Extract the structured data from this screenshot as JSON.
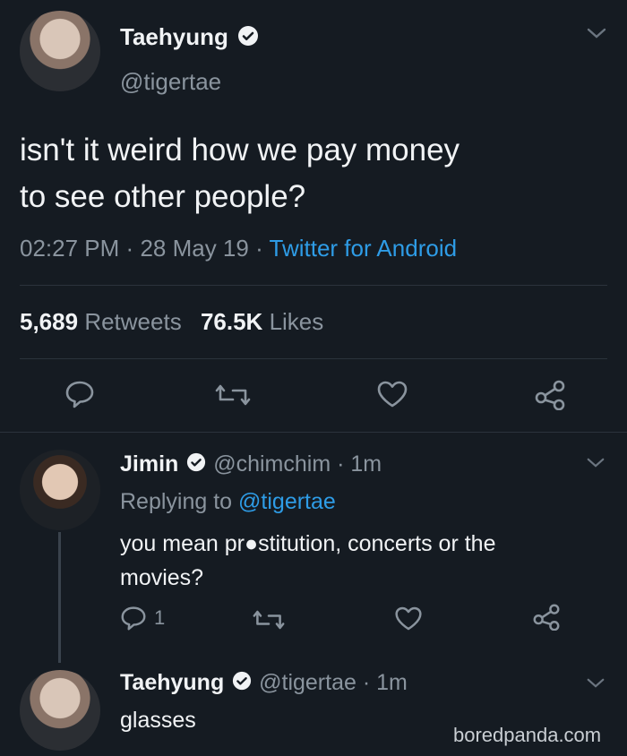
{
  "main_tweet": {
    "name": "Taehyung",
    "handle": "@tigertae",
    "text_line1": "isn't it weird how we pay money",
    "text_line2": "to see other people?",
    "time": "02:27 PM",
    "dot1": "·",
    "date": "28 May 19",
    "dot2": "·",
    "source": "Twitter for Android",
    "retweets_count": "5,689",
    "retweets_label": "Retweets",
    "likes_count": "76.5K",
    "likes_label": "Likes"
  },
  "reply1": {
    "name": "Jimin",
    "handle_time": "@chimchim · 1m",
    "replying_prefix": "Replying to",
    "replying_handle": "@tigertae",
    "text_line1": "you mean pr●stitution, concerts or the",
    "text_line2": "movies?",
    "reply_count": "1"
  },
  "reply2": {
    "name": "Taehyung",
    "handle_time": "@tigertae · 1m",
    "text": "glasses"
  },
  "watermark": "boredpanda.com",
  "colors": {
    "background": "#151b22",
    "link_blue": "#2e9ce6",
    "muted_gray": "#8a949e"
  }
}
